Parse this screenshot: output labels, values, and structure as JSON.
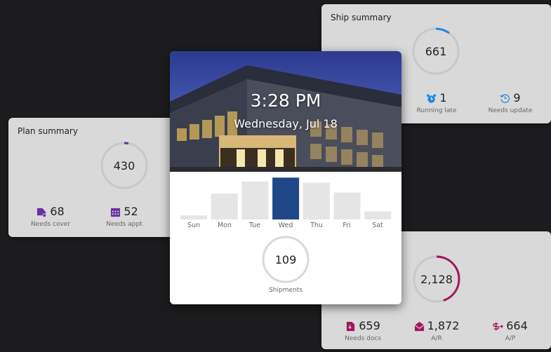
{
  "ship_summary": {
    "title": "Ship summary",
    "total": "661",
    "progress": 0.1,
    "stats": [
      {
        "value": "1",
        "label": "Running late",
        "icon": "alarm-clock-icon"
      },
      {
        "value": "9",
        "label": "Needs update",
        "icon": "clock-refresh-icon"
      }
    ]
  },
  "plan_summary": {
    "title": "Plan summary",
    "total": "430",
    "progress": 0.03,
    "stats": [
      {
        "value": "68",
        "label": "Needs cover",
        "icon": "truck-icon"
      },
      {
        "value": "52",
        "label": "Needs appt",
        "icon": "calendar-icon"
      }
    ]
  },
  "billing_summary": {
    "total": "2,128",
    "progress": 0.45,
    "stats": [
      {
        "value": "659",
        "label": "Needs docs",
        "icon": "document-icon"
      },
      {
        "value": "1,872",
        "label": "A/R",
        "icon": "envelope-icon"
      },
      {
        "value": "664",
        "label": "A/P",
        "icon": "payment-out-icon"
      }
    ]
  },
  "center": {
    "time": "3:28 PM",
    "date": "Wednesday, Jul 18",
    "shipments_total": "109",
    "shipments_label": "Shipments"
  },
  "colors": {
    "accent_blue": "#1e88e5",
    "accent_purple": "#6a2fa0",
    "accent_magenta": "#a0195e",
    "bar_selected": "#1f4788",
    "bar_default": "#e5e5e5"
  },
  "chart_data": {
    "type": "bar",
    "categories": [
      "Sun",
      "Mon",
      "Tue",
      "Wed",
      "Thu",
      "Fri",
      "Sat"
    ],
    "values": [
      4,
      26,
      38,
      42,
      37,
      27,
      8
    ],
    "selected": "Wed",
    "ylim": [
      0,
      45
    ],
    "grid": false
  }
}
